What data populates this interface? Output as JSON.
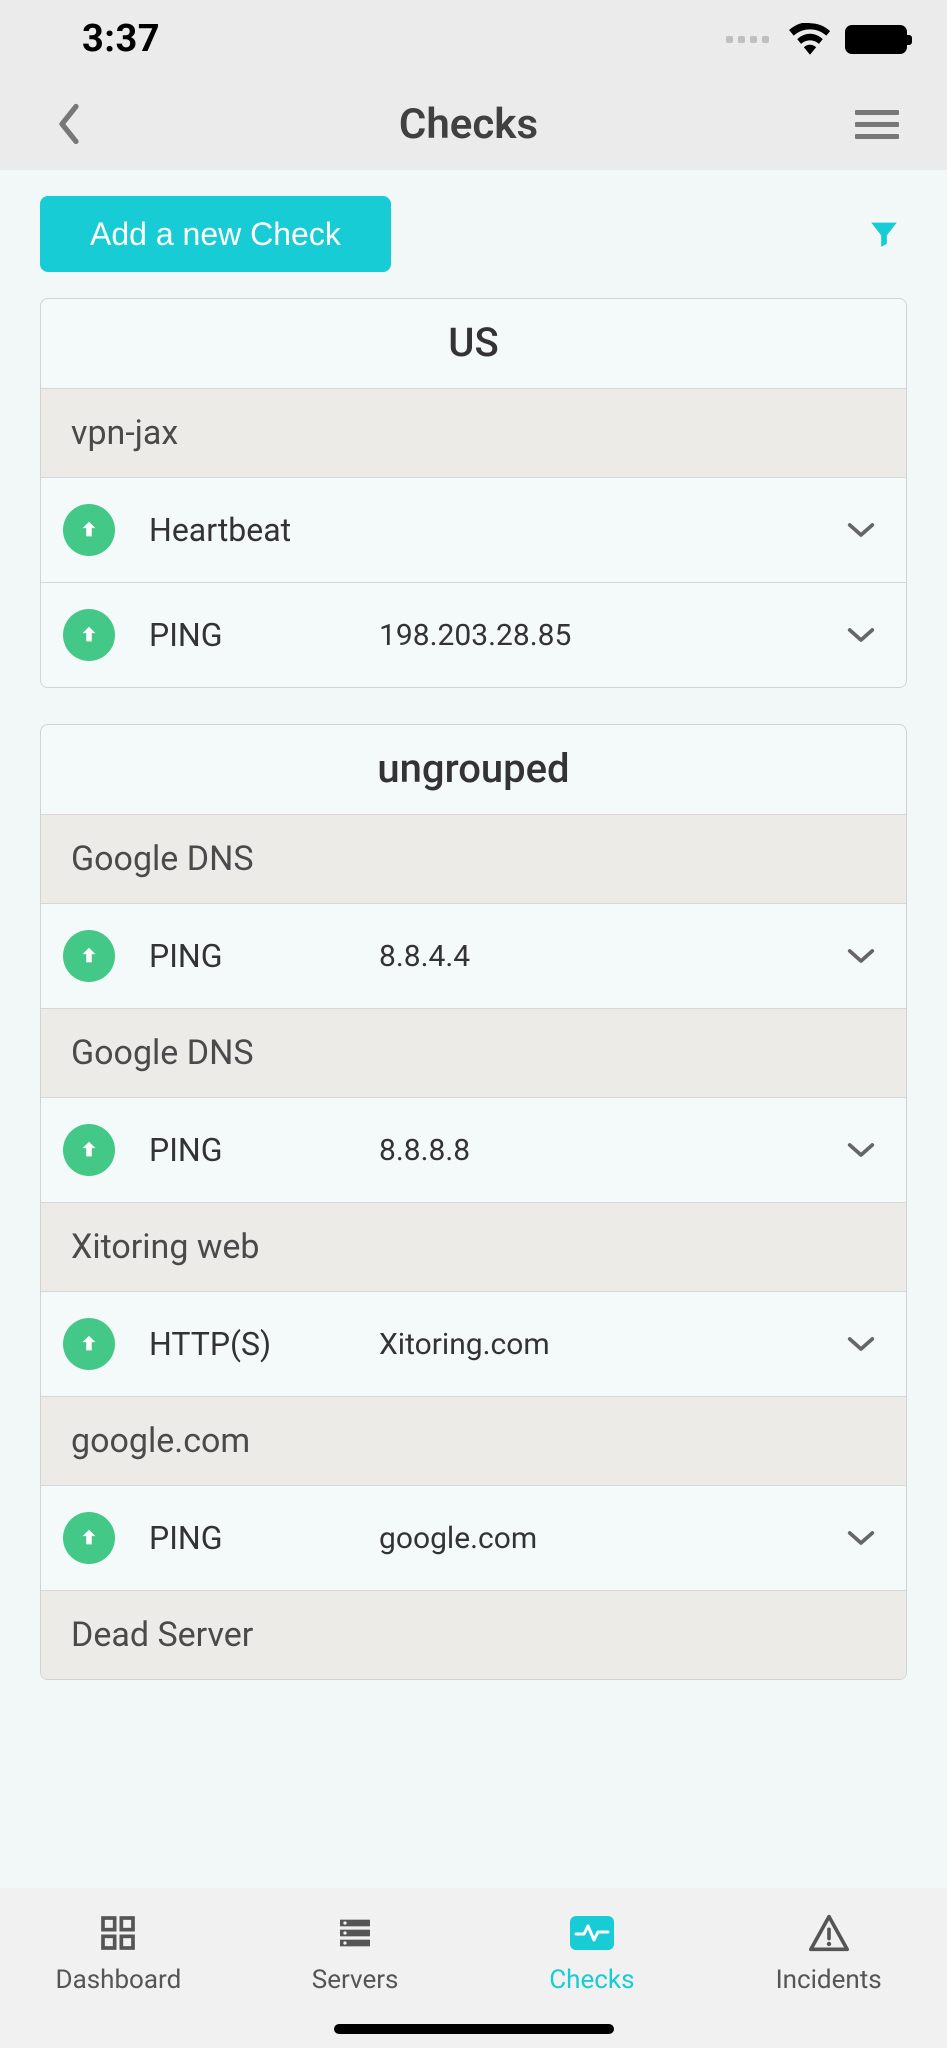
{
  "status_bar": {
    "time": "3:37"
  },
  "header": {
    "title": "Checks"
  },
  "actions": {
    "add_label": "Add a new Check"
  },
  "groups": [
    {
      "title": "US",
      "subgroups": [
        {
          "name": "vpn-jax",
          "checks": [
            {
              "type": "Heartbeat",
              "target": "",
              "status": "up"
            },
            {
              "type": "PING",
              "target": "198.203.28.85",
              "status": "up"
            }
          ]
        }
      ]
    },
    {
      "title": "ungrouped",
      "subgroups": [
        {
          "name": "Google DNS",
          "checks": [
            {
              "type": "PING",
              "target": "8.8.4.4",
              "status": "up"
            }
          ]
        },
        {
          "name": "Google DNS",
          "checks": [
            {
              "type": "PING",
              "target": "8.8.8.8",
              "status": "up"
            }
          ]
        },
        {
          "name": "Xitoring web",
          "checks": [
            {
              "type": "HTTP(S)",
              "target": "Xitoring.com",
              "status": "up"
            }
          ]
        },
        {
          "name": "google.com",
          "checks": [
            {
              "type": "PING",
              "target": "google.com",
              "status": "up"
            }
          ]
        },
        {
          "name": "Dead Server",
          "checks": []
        }
      ]
    }
  ],
  "tabs": {
    "dashboard": "Dashboard",
    "servers": "Servers",
    "checks": "Checks",
    "incidents": "Incidents",
    "active": "checks"
  },
  "colors": {
    "accent": "#18ccd6",
    "status_up": "#44c887"
  }
}
